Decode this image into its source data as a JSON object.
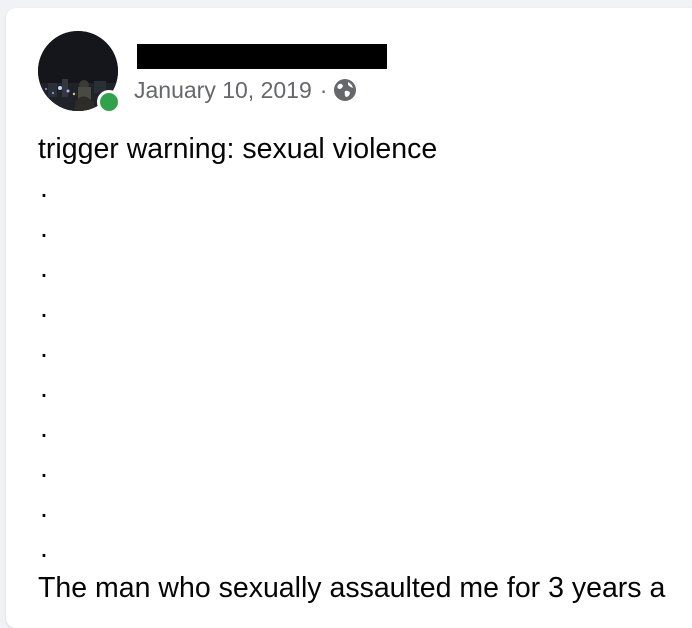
{
  "post": {
    "author": {
      "online": true,
      "avatar_icon": "profile-photo"
    },
    "date": "January 10, 2019",
    "separator": "·",
    "privacy_icon": "globe-icon",
    "body": {
      "trigger_line": "trigger warning: sexual violence",
      "dots": [
        ".",
        ".",
        ".",
        ".",
        ".",
        ".",
        ".",
        ".",
        ".",
        "."
      ],
      "last_line": "The man who sexually assaulted me for 3 years a"
    }
  },
  "colors": {
    "online": "#31a24c",
    "meta_text": "#65676b",
    "body_text": "#050505",
    "card": "#ffffff",
    "background": "#f0f2f5"
  }
}
